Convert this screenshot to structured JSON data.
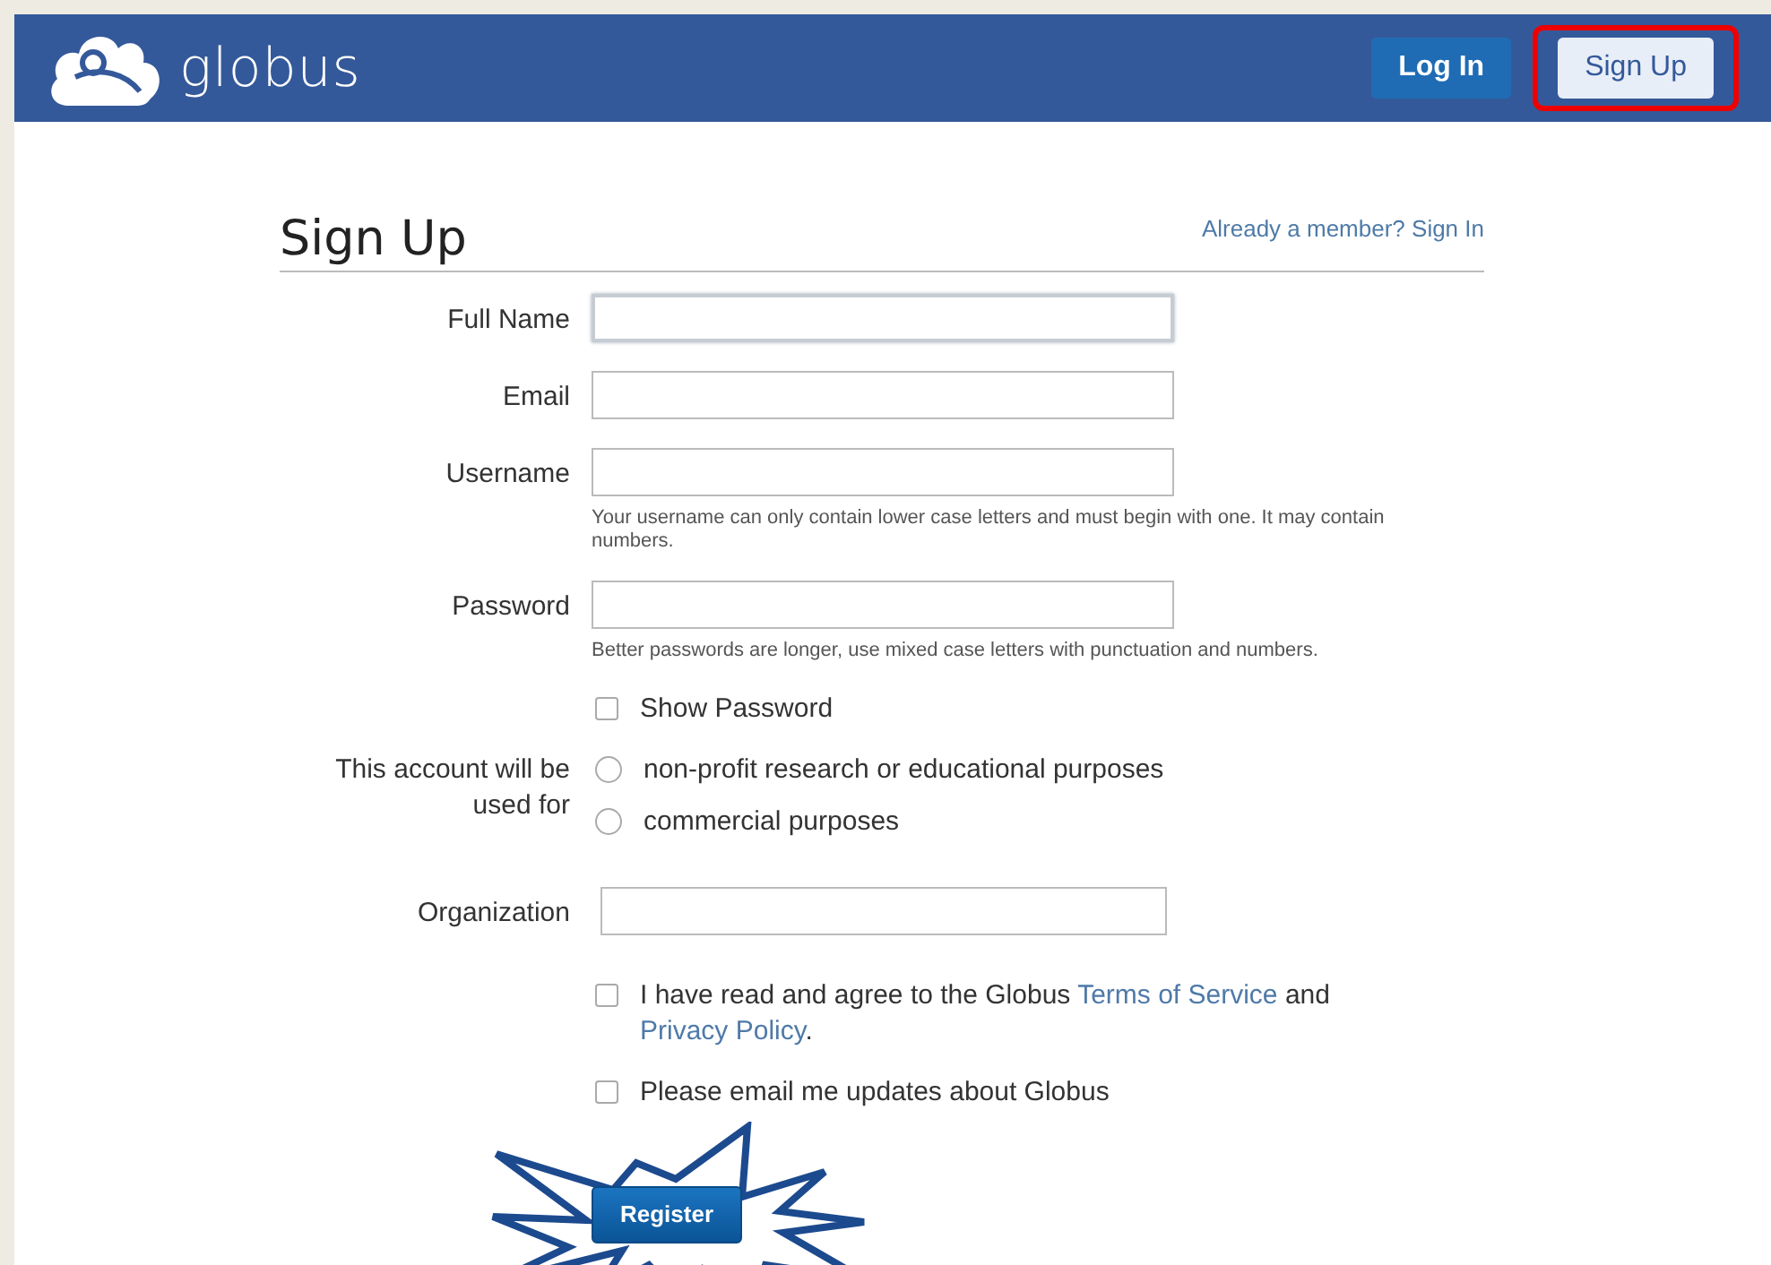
{
  "header": {
    "logo_text": "globus",
    "buttons": [
      {
        "label": "Log In",
        "selected": false
      },
      {
        "label": "Sign Up",
        "selected": true,
        "highlighted": true
      }
    ]
  },
  "form": {
    "title": "Sign Up",
    "sign_in_link": "Already a member? Sign In",
    "fields": [
      {
        "label": "Full Name",
        "focused": true
      },
      {
        "label": "Email",
        "focused": false
      },
      {
        "label": "Username",
        "focused": false,
        "hint": "Your username can only contain lower case letters and must begin with one. It may contain numbers."
      },
      {
        "label": "Password",
        "focused": false,
        "hint": "Better passwords are longer, use mixed case letters with punctuation and numbers."
      }
    ],
    "show_password": {
      "label": "Show Password",
      "checked": false
    },
    "usage": {
      "label": "This account will be used for",
      "options": [
        {
          "label": "non-profit research or educational purposes",
          "selected": false
        },
        {
          "label": "commercial purposes",
          "selected": false
        }
      ]
    },
    "organization": {
      "label": "Organization"
    },
    "agreement": {
      "checked": false,
      "before": "I have read and agree to the Globus ",
      "terms_link": "Terms of Service",
      "middle": " and ",
      "privacy_link": "Privacy Policy",
      "after": "."
    },
    "updates": {
      "label": "Please email me updates about Globus",
      "checked": false
    },
    "register_button": {
      "label": "Register",
      "highlighted": true
    }
  }
}
